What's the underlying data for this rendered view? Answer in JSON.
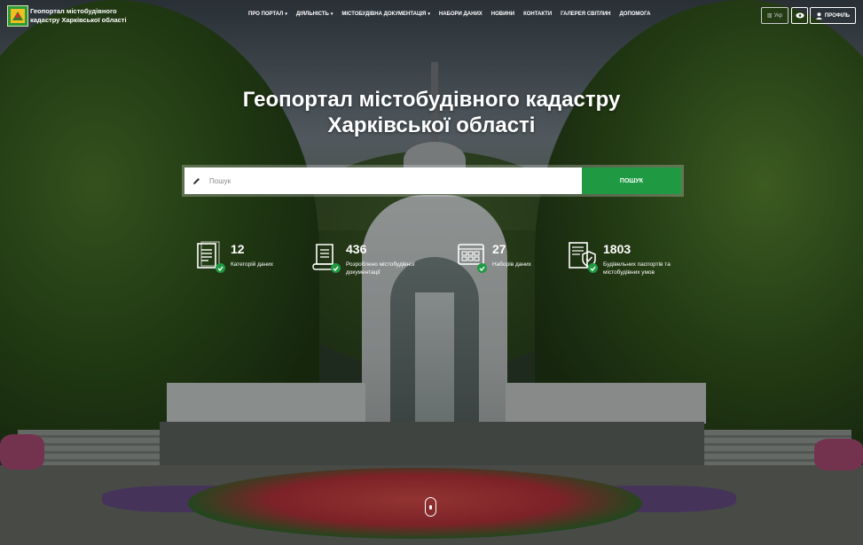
{
  "header": {
    "brand": "Геопортал містобудівного кадастру Харківської області",
    "nav": [
      {
        "label": "ПРО ПОРТАЛ",
        "dropdown": true
      },
      {
        "label": "ДІЯЛЬНІСТЬ",
        "dropdown": true
      },
      {
        "label": "МІСТОБУДІВНА ДОКУМЕНТАЦІЯ",
        "dropdown": true
      },
      {
        "label": "НАБОРИ ДАНИХ",
        "dropdown": false
      },
      {
        "label": "НОВИНИ",
        "dropdown": false
      },
      {
        "label": "КОНТАКТИ",
        "dropdown": false
      },
      {
        "label": "ГАЛЕРЕЯ СВІТЛИН",
        "dropdown": false
      },
      {
        "label": "ДОПОМОГА",
        "dropdown": false
      }
    ],
    "language": "Укр",
    "profile": "ПРОФІЛЬ"
  },
  "hero": {
    "title_line1": "Геопортал містобудівного кадастру",
    "title_line2": "Харківської області"
  },
  "search": {
    "placeholder": "Пошук",
    "button": "ПОШУК"
  },
  "stats": [
    {
      "value": "12",
      "label_line1": "Категорій даних",
      "label_line2": "",
      "icon": "document-list-icon"
    },
    {
      "value": "436",
      "label_line1": "Розроблено містобудівної",
      "label_line2": "документації",
      "icon": "scroll-document-icon"
    },
    {
      "value": "27",
      "label_line1": "Наборів даних",
      "label_line2": "",
      "icon": "dataset-grid-icon"
    },
    {
      "value": "1803",
      "label_line1": "Будівельних паспортів та",
      "label_line2": "містобудівних умов",
      "icon": "passport-shield-icon"
    }
  ],
  "colors": {
    "accent": "#1f9a43"
  }
}
